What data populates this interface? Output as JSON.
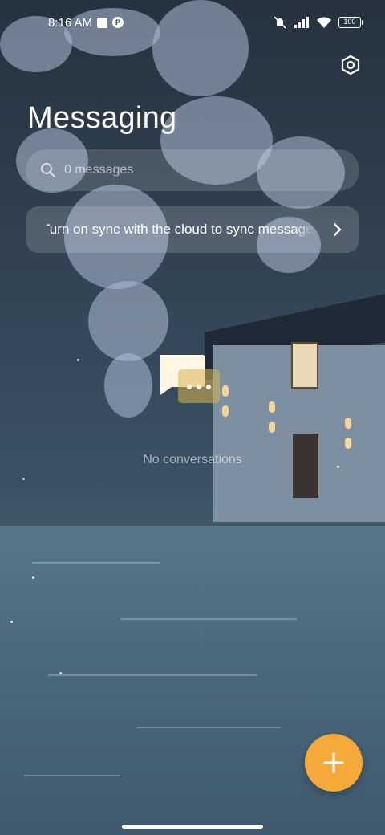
{
  "status_bar": {
    "time": "8:16 AM",
    "battery": "100",
    "icons": [
      "notification-square-icon",
      "app-badge-icon",
      "mute-icon",
      "signal-icon",
      "wifi-icon",
      "battery-icon"
    ]
  },
  "header": {
    "title": "Messaging",
    "settings_icon": "settings-hexagon-icon"
  },
  "search": {
    "placeholder": "0 messages",
    "value": ""
  },
  "sync_banner": {
    "text": "Turn on sync with the cloud to sync messages",
    "icon": "chevron-right-icon"
  },
  "empty_state": {
    "icon": "chat-bubbles-icon",
    "text": "No conversations"
  },
  "fab": {
    "icon": "plus-icon"
  },
  "colors": {
    "accent": "#f5a93a",
    "empty_icon_primary": "#fff6e6",
    "empty_icon_secondary": "#d8b452"
  }
}
